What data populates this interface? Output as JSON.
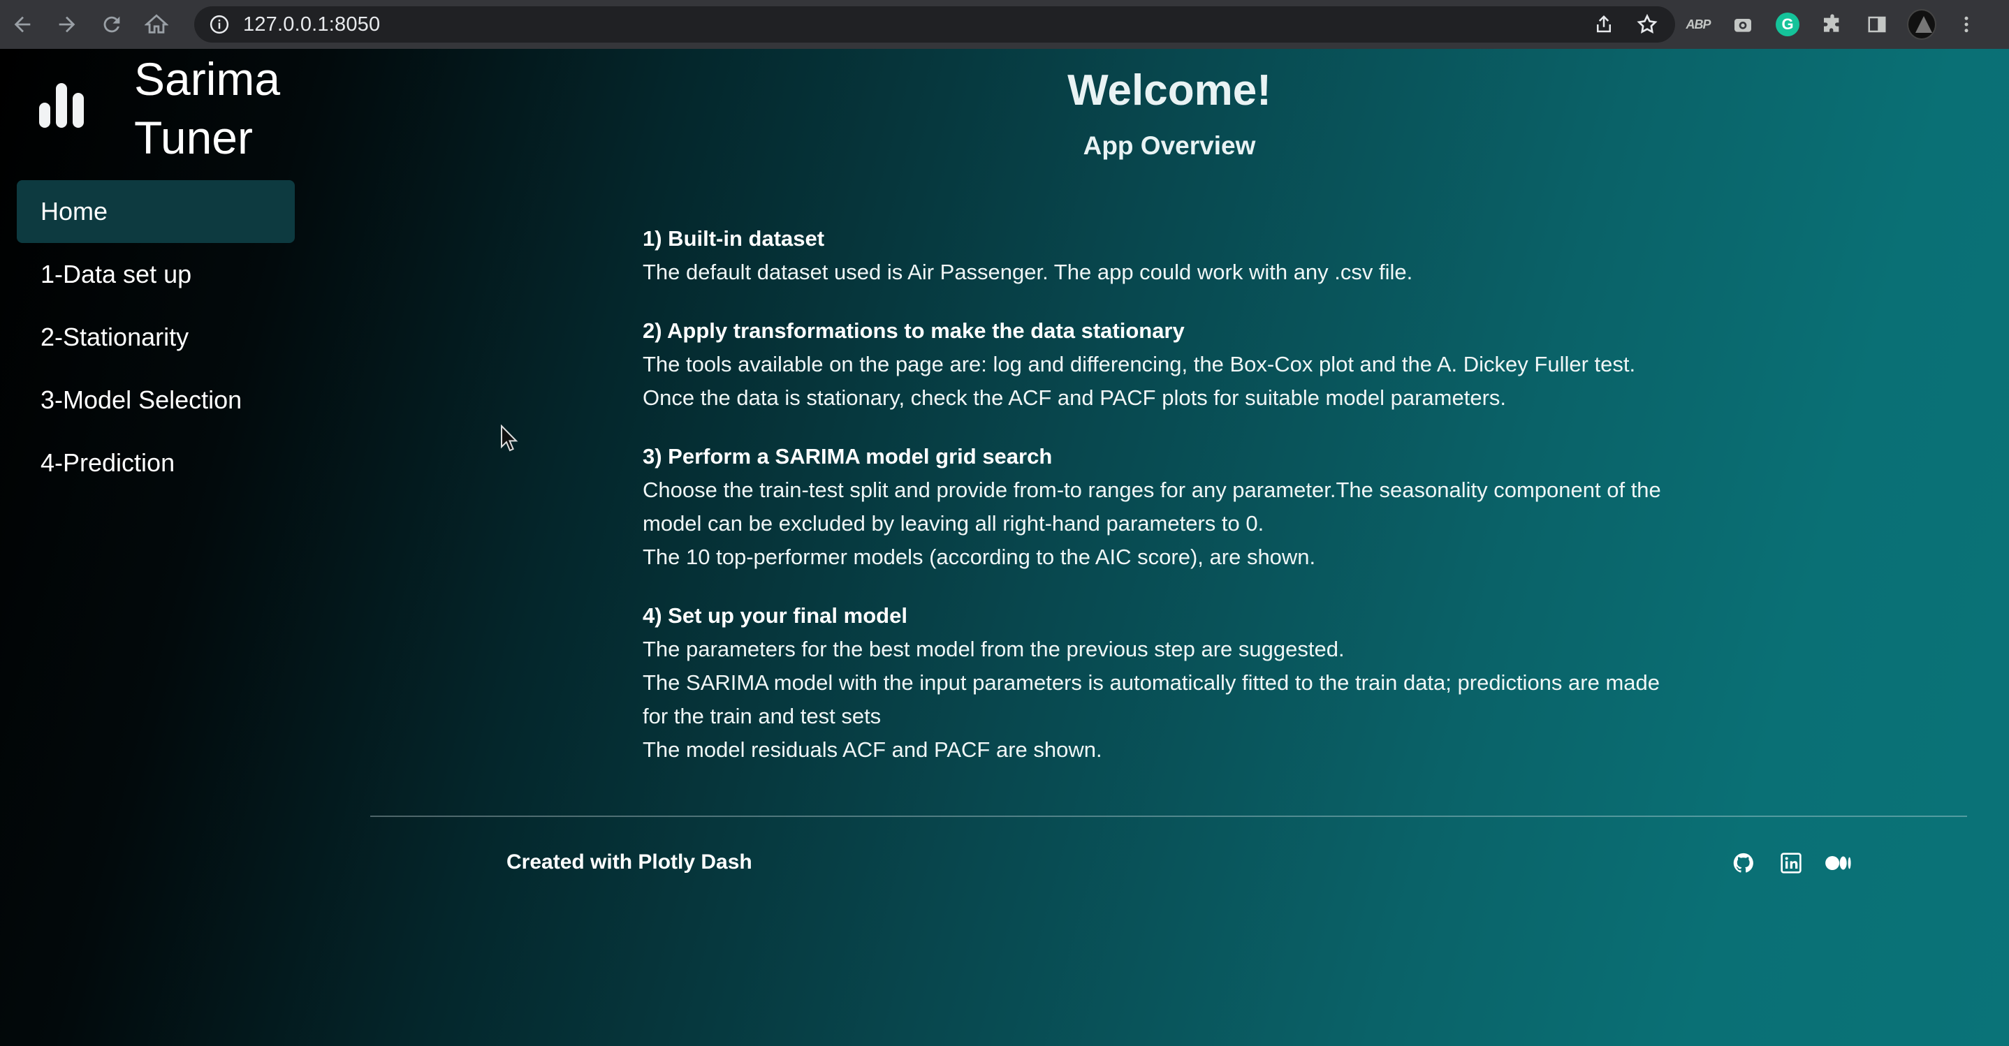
{
  "browser": {
    "url": "127.0.0.1:8050",
    "extension_abp_label": "ABP",
    "extension_grammarly_label": "G"
  },
  "sidebar": {
    "brand_line1": "Sarima",
    "brand_line2": "Tuner",
    "items": [
      {
        "label": "Home",
        "active": true
      },
      {
        "label": "1-Data set up",
        "active": false
      },
      {
        "label": "2-Stationarity",
        "active": false
      },
      {
        "label": "3-Model Selection",
        "active": false
      },
      {
        "label": "4-Prediction",
        "active": false
      }
    ]
  },
  "main": {
    "title": "Welcome!",
    "subtitle": "App Overview",
    "sections": [
      {
        "heading": "1) Built-in dataset",
        "lines": [
          "The default dataset used is Air Passenger. The app could work with any .csv file."
        ]
      },
      {
        "heading": "2) Apply transformations to make the data stationary",
        "lines": [
          "The tools available on the page are: log and differencing, the Box-Cox plot and the A. Dickey Fuller test.",
          "Once the data is stationary, check the ACF and PACF plots for suitable model parameters."
        ]
      },
      {
        "heading": "3) Perform a SARIMA model grid search",
        "lines": [
          "Choose the train-test split and provide from-to ranges for any parameter.The seasonality component of the",
          "model can be excluded by leaving all right-hand parameters to 0.",
          "The 10 top-performer models (according to the AIC score), are shown."
        ]
      },
      {
        "heading": "4) Set up your final model",
        "lines": [
          "The parameters for the best model from the previous step are suggested.",
          "The SARIMA model with the input parameters is automatically fitted to the train data; predictions are made",
          "for the train and test sets",
          "The model residuals ACF and PACF are shown."
        ]
      }
    ]
  },
  "footer": {
    "text": "Created with Plotly Dash",
    "icons": [
      "github-icon",
      "linkedin-icon",
      "medium-icon"
    ]
  },
  "colors": {
    "active_nav_bg": "#0d3a40",
    "gradient_end": "#0a7378"
  }
}
